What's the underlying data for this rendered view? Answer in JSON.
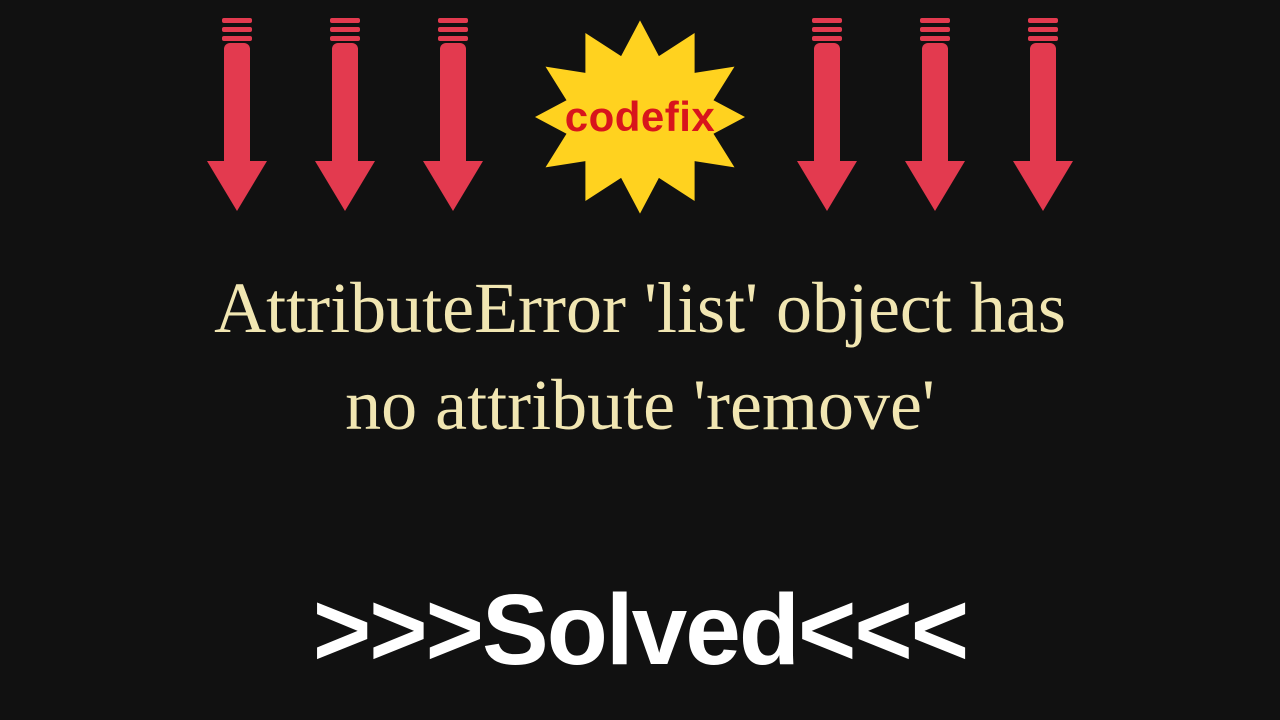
{
  "badge": {
    "label": "codefix"
  },
  "error": {
    "line1": "AttributeError 'list' object has",
    "line2": "no attribute 'remove'"
  },
  "solved": {
    "left_chevrons": ">>>",
    "word": "Solved",
    "right_chevrons": "<<<"
  },
  "colors": {
    "bg": "#111111",
    "arrow": "#e33a4f",
    "burst": "#ffd21f",
    "burst_text": "#d8151c",
    "error_text": "#f1e6b2",
    "solved_text": "#ffffff"
  }
}
